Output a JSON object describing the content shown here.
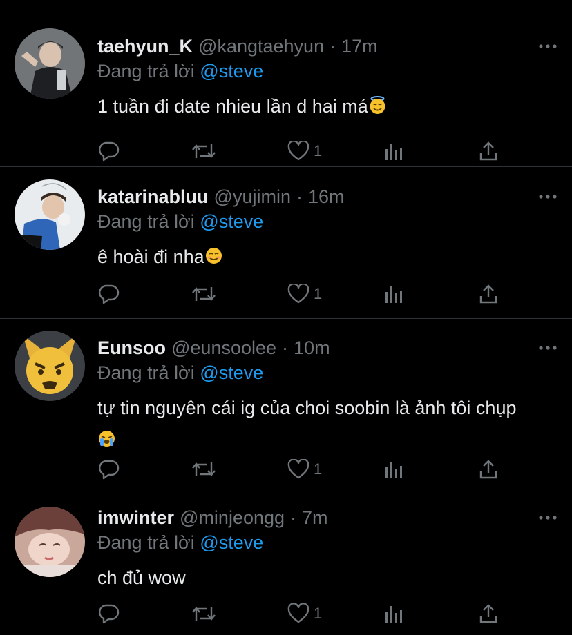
{
  "tweets": [
    {
      "name": "taehyun_K",
      "handle": "@kangtaehyun",
      "time": "17m",
      "reply_prefix": "Đang trả lời",
      "reply_to": "@steve",
      "text": "1 tuần đi date nhieu lần d hai má",
      "emoji": "smiling-face-with-halo",
      "like_count": "1"
    },
    {
      "name": "katarinabluu",
      "handle": "@yujimin",
      "time": "16m",
      "reply_prefix": "Đang trả lời",
      "reply_to": "@steve",
      "text": "ê hoài đi nha",
      "emoji": "smiling-face",
      "like_count": "1"
    },
    {
      "name": "Eunsoo",
      "handle": "@eunsoolee",
      "time": "10m",
      "reply_prefix": "Đang trả lời",
      "reply_to": "@steve",
      "text": "tự tin nguyên cái ig của choi soobin là ảnh tôi chụp",
      "emoji": "loudly-crying-face",
      "like_count": "1"
    },
    {
      "name": "imwinter",
      "handle": "@minjeongg",
      "time": "7m",
      "reply_prefix": "Đang trả lời",
      "reply_to": "@steve",
      "text": "ch đủ wow",
      "emoji": "",
      "like_count": "1"
    }
  ],
  "colors": {
    "background": "#000000",
    "text": "#e7e9ea",
    "muted": "#71767b",
    "link": "#1d9bf0",
    "divider": "#2f3336"
  }
}
